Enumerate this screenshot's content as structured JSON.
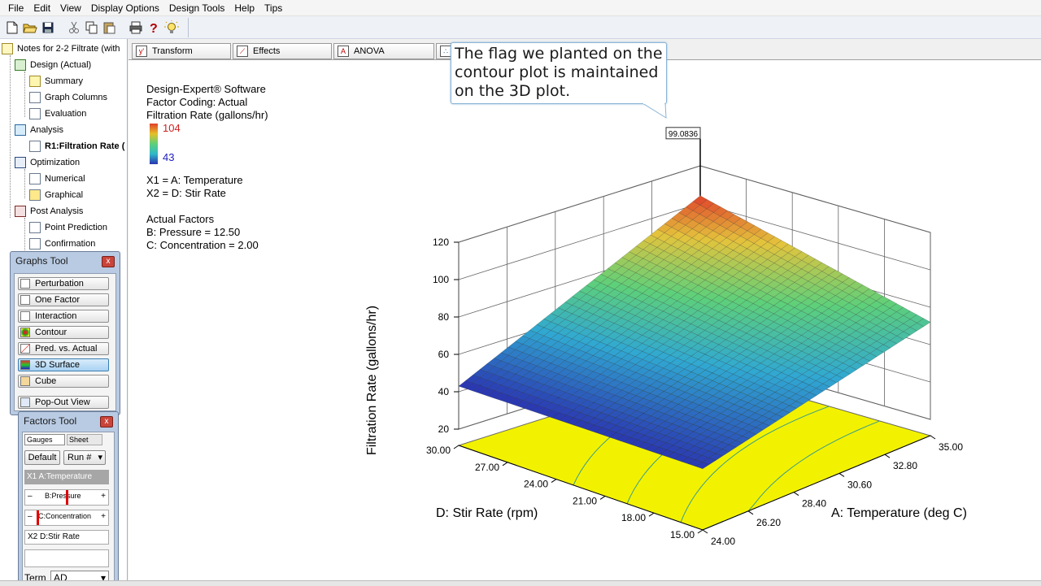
{
  "menubar": {
    "items": [
      "File",
      "Edit",
      "View",
      "Display Options",
      "Design Tools",
      "Help",
      "Tips"
    ]
  },
  "toolbar": {
    "icons": [
      "new-file-icon",
      "open-folder-icon",
      "save-icon",
      "cut-icon",
      "copy-icon",
      "paste-icon",
      "print-icon",
      "help-icon",
      "tip-bulb-icon"
    ]
  },
  "tree": {
    "root": "Notes for 2-2 Filtrate (with",
    "design": "Design (Actual)",
    "summary": "Summary",
    "graph_columns": "Graph Columns",
    "evaluation": "Evaluation",
    "analysis": "Analysis",
    "r1": "R1:Filtration Rate (",
    "optimization": "Optimization",
    "numerical": "Numerical",
    "graphical": "Graphical",
    "post_analysis": "Post Analysis",
    "point_prediction": "Point Prediction",
    "confirmation": "Confirmation"
  },
  "graphs_tool": {
    "title": "Graphs Tool",
    "close": "x",
    "buttons": [
      "Perturbation",
      "One Factor",
      "Interaction",
      "Contour",
      "Pred. vs. Actual",
      "3D Surface",
      "Cube"
    ],
    "active": "3D Surface",
    "popout": "Pop-Out View"
  },
  "factors_tool": {
    "title": "Factors Tool",
    "close": "x",
    "tab_gauges": "Gauges",
    "tab_sheet": "Sheet",
    "default_btn": "Default",
    "run_select": "Run #",
    "x1_label": "X1",
    "x1_factor": "A:Temperature",
    "b_factor": "B:Pressure",
    "c_factor": "C:Concentration",
    "x2_label": "X2",
    "x2_factor": "D:Stir Rate",
    "minus": "–",
    "plus": "+",
    "term_label": "Term",
    "term_value": "AD"
  },
  "tabs": [
    {
      "label": "Transform",
      "icon": "transform-icon"
    },
    {
      "label": "Effects",
      "icon": "effects-icon"
    },
    {
      "label": "ANOVA",
      "icon": "anova-icon"
    },
    {
      "label": "",
      "icon": "diagnostics-icon"
    }
  ],
  "info": {
    "software": "Design-Expert® Software",
    "coding": "Factor Coding: Actual",
    "response": "Filtration Rate (gallons/hr)",
    "legend_high": "104",
    "legend_low": "43",
    "x1": "X1 = A: Temperature",
    "x2": "X2 = D: Stir Rate",
    "actual_factors": "Actual Factors",
    "b_value": "B: Pressure = 12.50",
    "c_value": "C: Concentration = 2.00"
  },
  "callout": {
    "text": "The flag we planted on the contour plot is maintained on the 3D plot."
  },
  "chart_data": {
    "type": "surface3d",
    "flag_value": "99.0836",
    "zlabel": "Filtration Rate (gallons/hr)",
    "xlabel": "A: Temperature (deg C)",
    "ylabel": "D: Stir Rate (rpm)",
    "z_ticks": [
      "20",
      "40",
      "60",
      "80",
      "100",
      "120"
    ],
    "a_ticks": [
      "24.00",
      "26.20",
      "28.40",
      "30.60",
      "32.80",
      "35.00"
    ],
    "d_ticks": [
      "15.00",
      "18.00",
      "21.00",
      "24.00",
      "27.00",
      "30.00"
    ],
    "zlim": [
      20,
      120
    ],
    "surface_corners": {
      "A24_D30": 43,
      "A24_D15": 44,
      "A35_D15": 72,
      "A35_D30": 104
    },
    "legend_range": [
      43,
      104
    ],
    "colors": {
      "high": "#e0402a",
      "mid": "#5ed07a",
      "low": "#2a33b0",
      "floor": "#f2f200"
    }
  }
}
